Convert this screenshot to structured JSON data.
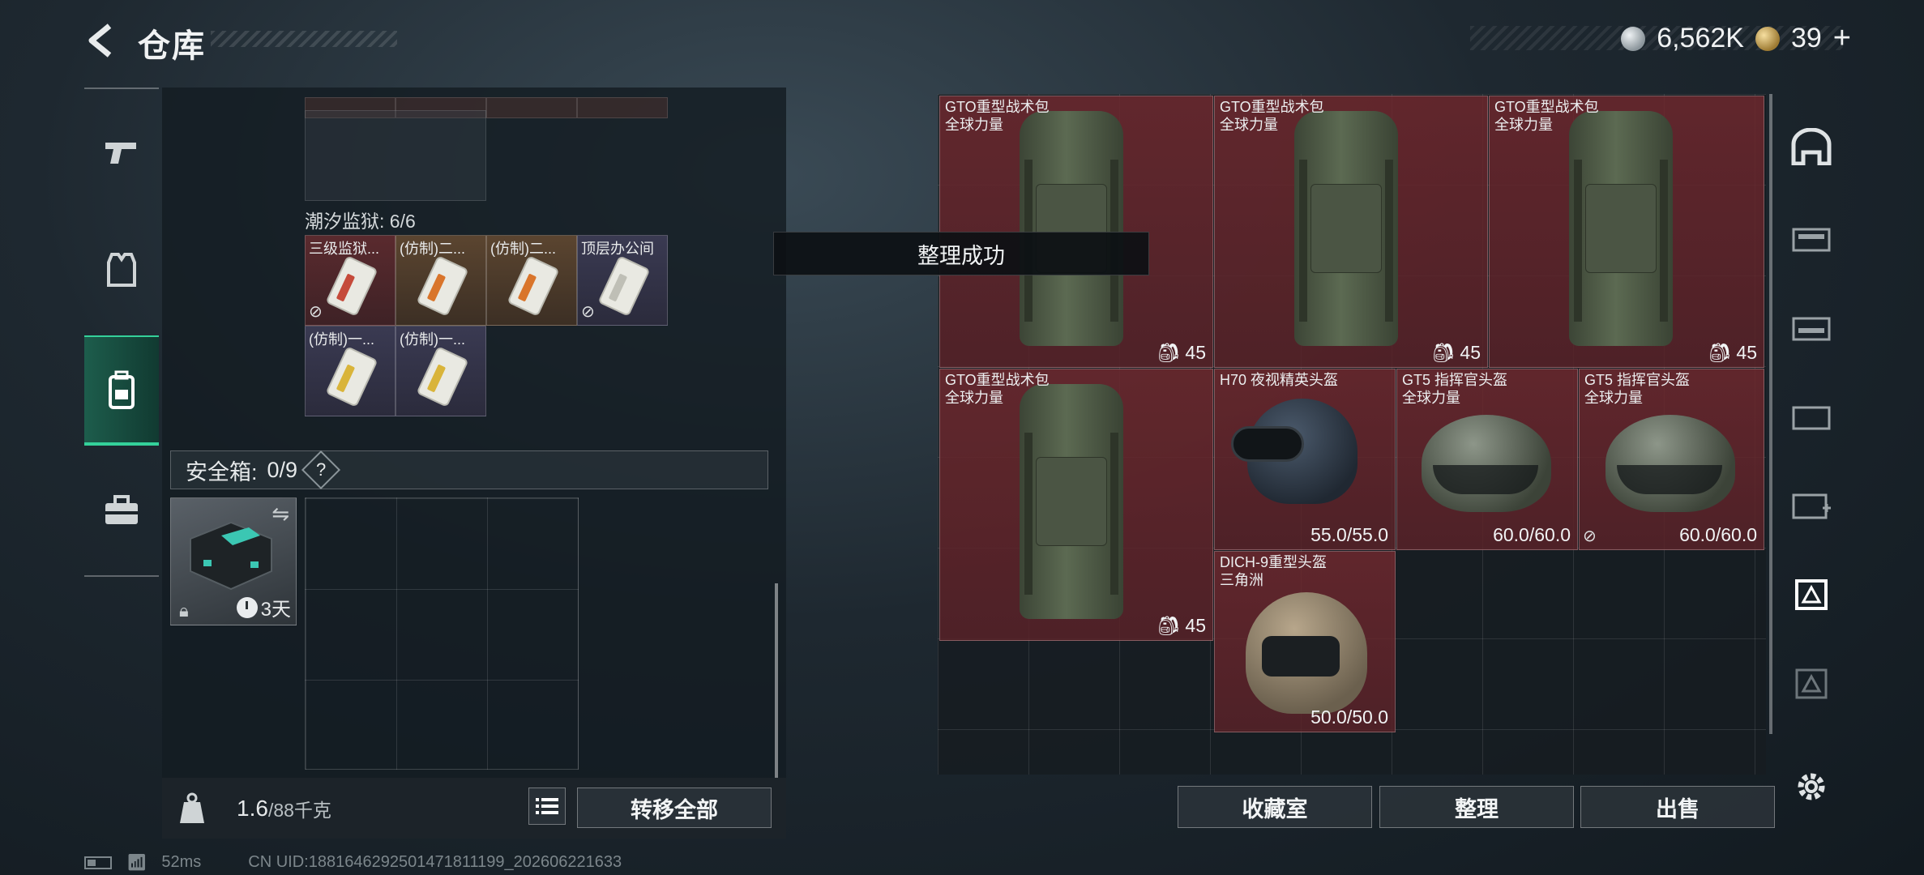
{
  "header": {
    "title": "仓库"
  },
  "currency": {
    "silver": "6,562K",
    "gold": "39",
    "plus": "+"
  },
  "left_panel": {
    "section_tide": "潮汐监狱: 6/6",
    "tide_items": [
      {
        "label": "三级监狱...",
        "bg": "red"
      },
      {
        "label": "(仿制)二...",
        "bg": "brown"
      },
      {
        "label": "(仿制)二...",
        "bg": "brown"
      },
      {
        "label": "顶层办公间",
        "bg": "purple"
      },
      {
        "label": "(仿制)一...",
        "bg": "purple"
      },
      {
        "label": "(仿制)一...",
        "bg": "purple"
      }
    ],
    "safebox": {
      "label": "安全箱:",
      "count": "0/9",
      "help": "?"
    },
    "safe_item": {
      "timer": "3天"
    },
    "weight": {
      "current": "1.6",
      "max": "/88千克"
    },
    "transfer_all": "转移全部"
  },
  "toast": "整理成功",
  "right_panel": {
    "items": [
      {
        "name": "GTO重型战术包",
        "sub": "全球力量",
        "cap": "45"
      },
      {
        "name": "GTO重型战术包",
        "sub": "全球力量",
        "cap": "45"
      },
      {
        "name": "GTO重型战术包",
        "sub": "全球力量",
        "cap": "45"
      },
      {
        "name": "GTO重型战术包",
        "sub": "全球力量",
        "cap": "45"
      },
      {
        "name": "H70 夜视精英头盔",
        "sub": "",
        "dur": "55.0/55.0"
      },
      {
        "name": "GT5 指挥官头盔",
        "sub": "全球力量",
        "dur": "60.0/60.0"
      },
      {
        "name": "GT5 指挥官头盔",
        "sub": "全球力量",
        "dur": "60.0/60.0"
      },
      {
        "name": "DICH-9重型头盔",
        "sub": "三角洲",
        "dur": "50.0/50.0"
      }
    ],
    "buttons": {
      "collection": "收藏室",
      "organize": "整理",
      "sell": "出售"
    }
  },
  "status_bar": {
    "ping": "52ms",
    "uid": "CN UID:1881646292501471811199_202606221633"
  },
  "colors": {
    "accent": "#34d19a",
    "item_red": "#6e282e"
  }
}
